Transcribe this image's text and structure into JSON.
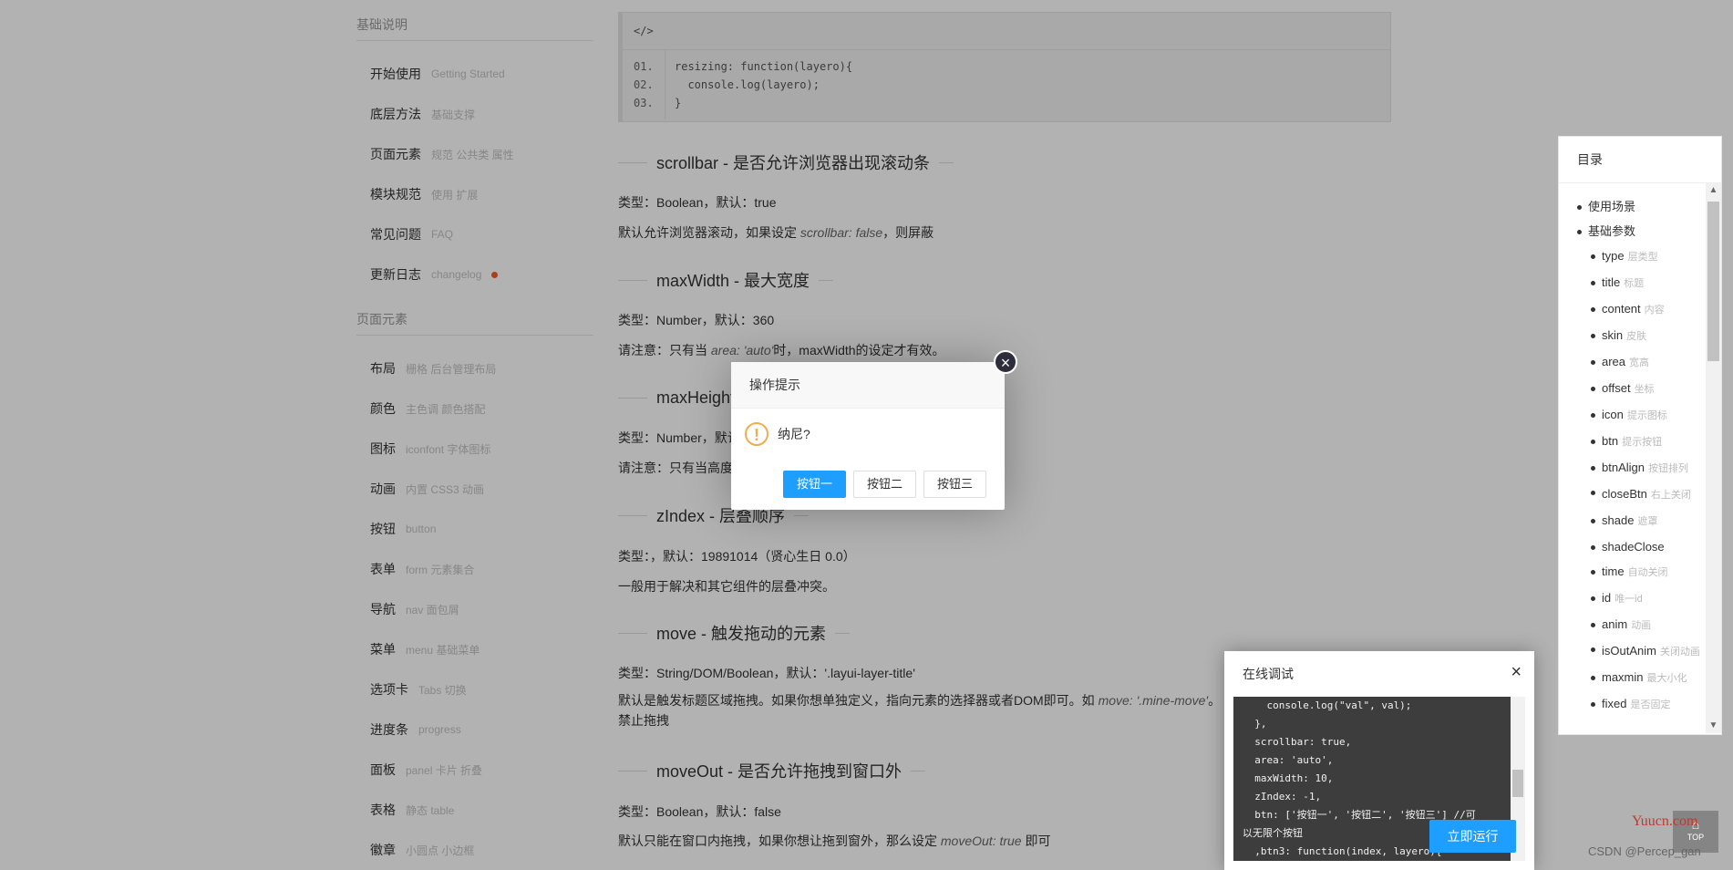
{
  "nav": {
    "section1_title": "基础说明",
    "section1_items": [
      {
        "label": "开始使用",
        "sub": "Getting Started"
      },
      {
        "label": "底层方法",
        "sub": "基础支撑"
      },
      {
        "label": "页面元素",
        "sub": "规范 公共类 属性"
      },
      {
        "label": "模块规范",
        "sub": "使用 扩展"
      },
      {
        "label": "常见问题",
        "sub": "FAQ"
      },
      {
        "label": "更新日志",
        "sub": "changelog"
      }
    ],
    "section2_title": "页面元素",
    "section2_items": [
      {
        "label": "布局",
        "sub": "栅格 后台管理布局"
      },
      {
        "label": "颜色",
        "sub": "主色调 颜色搭配"
      },
      {
        "label": "图标",
        "sub": "iconfont 字体图标"
      },
      {
        "label": "动画",
        "sub": "内置 CSS3 动画"
      },
      {
        "label": "按钮",
        "sub": "button"
      },
      {
        "label": "表单",
        "sub": "form 元素集合"
      },
      {
        "label": "导航",
        "sub": "nav 面包屑"
      },
      {
        "label": "菜单",
        "sub": "menu 基础菜单"
      },
      {
        "label": "选项卡",
        "sub": "Tabs 切换"
      },
      {
        "label": "进度条",
        "sub": "progress"
      },
      {
        "label": "面板",
        "sub": "panel 卡片 折叠"
      },
      {
        "label": "表格",
        "sub": "静态 table"
      },
      {
        "label": "徽章",
        "sub": "小圆点 小边框"
      }
    ]
  },
  "code_box": {
    "header": "</>",
    "line_numbers": [
      "01.",
      "02.",
      "03."
    ],
    "lines": [
      "resizing: function(layero){",
      "  console.log(layero);",
      "}"
    ]
  },
  "sections": {
    "scrollbar": {
      "title": "scrollbar - 是否允许浏览器出现滚动条",
      "type": "类型：Boolean，默认：true",
      "desc_a": "默认允许浏览器滚动，如果设定 ",
      "desc_code": "scrollbar: false",
      "desc_b": "，则屏蔽"
    },
    "maxwidth": {
      "title": "maxWidth - 最大宽度",
      "type": "类型：Number，默认：360",
      "desc_a": "请注意：只有当 ",
      "desc_code": "area: 'auto'",
      "desc_b": "时，maxWidth的设定才有效。"
    },
    "maxheight": {
      "title": "maxHeight",
      "type": "类型：Number，默认",
      "desc": "请注意：只有当高度"
    },
    "zindex": {
      "title": "zIndex - 层叠顺序",
      "type": "类型：，默认：19891014（贤心生日 0.0）",
      "desc": "一般用于解决和其它组件的层叠冲突。"
    },
    "move": {
      "title": "move - 触发拖动的元素",
      "type": "类型：String/DOM/Boolean，默认：'.layui-layer-title'",
      "desc_a": "默认是触发标题区域拖拽。如果你想单独定义，指向元素的选择器或者DOM即可。如 ",
      "desc_code": "move: '.mine-move'",
      "desc_b": "。",
      "desc_line2": "禁止拖拽"
    },
    "moveout": {
      "title": "moveOut - 是否允许拖拽到窗口外",
      "type": "类型：Boolean，默认：false",
      "desc_a": "默认只能在窗口内拖拽，如果你想让拖到窗外，那么设定 ",
      "desc_code": "moveOut: true",
      "desc_b": " 即可"
    }
  },
  "toc": {
    "title": "目录",
    "items": [
      {
        "t": "使用场景",
        "s": "",
        "level": 1
      },
      {
        "t": "基础参数",
        "s": "",
        "level": 1
      },
      {
        "t": "type",
        "s": "层类型",
        "level": 2
      },
      {
        "t": "title",
        "s": "标题",
        "level": 2
      },
      {
        "t": "content",
        "s": "内容",
        "level": 2
      },
      {
        "t": "skin",
        "s": "皮肤",
        "level": 2
      },
      {
        "t": "area",
        "s": "宽高",
        "level": 2
      },
      {
        "t": "offset",
        "s": "坐标",
        "level": 2
      },
      {
        "t": "icon",
        "s": "提示图标",
        "level": 2
      },
      {
        "t": "btn",
        "s": "提示按钮",
        "level": 2
      },
      {
        "t": "btnAlign",
        "s": "按钮排列",
        "level": 2
      },
      {
        "t": "closeBtn",
        "s": "右上关闭",
        "level": 2
      },
      {
        "t": "shade",
        "s": "遮罩",
        "level": 2
      },
      {
        "t": "shadeClose",
        "s": "",
        "level": 2
      },
      {
        "t": "time",
        "s": "自动关闭",
        "level": 2
      },
      {
        "t": "id",
        "s": "唯一id",
        "level": 2
      },
      {
        "t": "anim",
        "s": "动画",
        "level": 2
      },
      {
        "t": "isOutAnim",
        "s": "关闭动画",
        "level": 2
      },
      {
        "t": "maxmin",
        "s": "最大小化",
        "level": 2
      },
      {
        "t": "fixed",
        "s": "是否固定",
        "level": 2
      }
    ]
  },
  "dialog": {
    "title": "操作提示",
    "message": "纳尼?",
    "icon": "!",
    "close": "×",
    "buttons": [
      "按钮一",
      "按钮二",
      "按钮三"
    ]
  },
  "debug": {
    "title": "在线调试",
    "close": "×",
    "code": "    console.log(\"val\", val);\n  },\n  scrollbar: true,\n  area: 'auto',\n  maxWidth: 10,\n  zIndex: -1,\n  btn: ['按钮一', '按钮二', '按钮三'] //可\n以无限个按钮\n  ,btn3: function(index, layero){",
    "run_label": "立即运行"
  },
  "watermark": {
    "site": "Yuucn.com",
    "csdn": "CSDN @Percep_gan",
    "top": "TOP"
  },
  "colors": {
    "primary": "#1e9fff",
    "dot": "#ff5722"
  }
}
